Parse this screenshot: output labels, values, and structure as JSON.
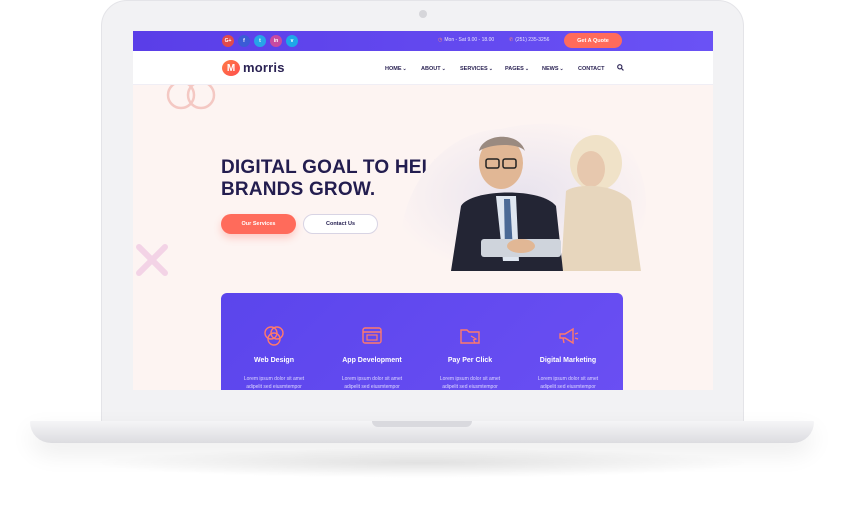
{
  "topbar": {
    "social": [
      {
        "label": "G+",
        "icon": "google-plus-icon",
        "color": "#e04b4b"
      },
      {
        "label": "f",
        "icon": "facebook-icon",
        "color": "#3b5bd6"
      },
      {
        "label": "t",
        "icon": "twitter-icon",
        "color": "#27a4e8"
      },
      {
        "label": "in",
        "icon": "instagram-icon",
        "color": "#c84aa0"
      },
      {
        "label": "v",
        "icon": "vimeo-icon",
        "color": "#1ea7e8"
      }
    ],
    "hours": "Mon - Sat  9.00 - 18.00",
    "phone": "(251) 235-3256",
    "quote_label": "Get A Quote"
  },
  "logo": {
    "mark": "M",
    "text": "morris"
  },
  "nav": {
    "items": [
      "HOME",
      "ABOUT",
      "SERVICES",
      "PAGES",
      "NEWS",
      "CONTACT"
    ],
    "dropdown_chevron": "⌄"
  },
  "hero": {
    "title_line1": "DIGITAL GOAL TO HELP",
    "title_line2": "BRANDS GROW.",
    "primary_button": "Our Services",
    "secondary_button": "Contact Us"
  },
  "services": [
    {
      "title": "Web Design",
      "desc": "Lorem ipsum dolor sit amet adipelit sed eiusmtempor",
      "icon": "circles-icon"
    },
    {
      "title": "App Development",
      "desc": "Lorem ipsum dolor sit amet adipelit sed eiusmtempor",
      "icon": "browser-icon"
    },
    {
      "title": "Pay Per Click",
      "desc": "Lorem ipsum dolor sit amet adipelit sed eiusmtempor",
      "icon": "folder-click-icon"
    },
    {
      "title": "Digital Marketing",
      "desc": "Lorem ipsum dolor sit amet adipelit sed eiusmtempor",
      "icon": "megaphone-icon"
    }
  ],
  "colors": {
    "primary": "#5b45ec",
    "accent": "#ff6b5b",
    "heading": "#231d4f"
  }
}
